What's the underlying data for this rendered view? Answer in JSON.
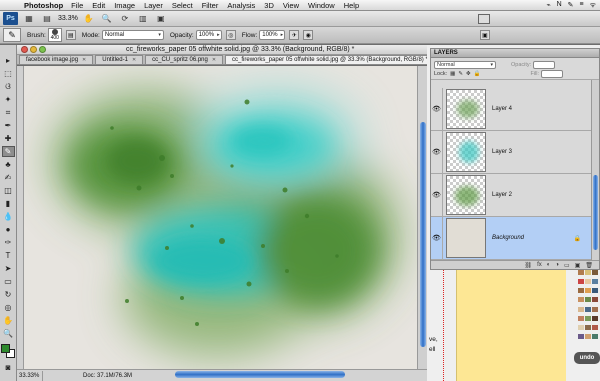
{
  "menubar": {
    "app_name": "Photoshop",
    "items": [
      "File",
      "Edit",
      "Image",
      "Layer",
      "Select",
      "Filter",
      "Analysis",
      "3D",
      "View",
      "Window",
      "Help"
    ],
    "status_icons": [
      "⌁",
      "N",
      "✎",
      "≡",
      "ᯤ"
    ]
  },
  "appbar": {
    "logo": "Ps",
    "zoom": "33.3%",
    "hand_icon": "hand-icon",
    "zoom_icon": "magnifier-icon"
  },
  "options": {
    "brush_label": "Brush:",
    "brush_size": "400",
    "mode_label": "Mode:",
    "mode_value": "Normal",
    "opacity_label": "Opacity:",
    "opacity_value": "100%",
    "flow_label": "Flow:",
    "flow_value": "100%"
  },
  "document": {
    "title": "cc_fireworks_paper 05 offwhite solid.jpg @ 33.3% (Background, RGB/8) *",
    "tabs": [
      {
        "label": "facebook image.jpg"
      },
      {
        "label": "Untitled-1"
      },
      {
        "label": "cc_CU_spritz 06.png"
      },
      {
        "label": "cc_fireworks_paper 05 offwhite solid.jpg @ 33.3% (Background, RGB/8) *"
      }
    ],
    "status_zoom": "33.33%",
    "doc_info": "Doc: 37.1M/76.3M"
  },
  "layers_panel": {
    "title": "LAYERS",
    "blend_mode": "Normal",
    "opacity_label": "Opacity:",
    "lock_label": "Lock:",
    "fill_label": "Fill:",
    "layers": [
      {
        "name": "Layer 4"
      },
      {
        "name": "Layer 3"
      },
      {
        "name": "Layer 2"
      },
      {
        "name": "Background"
      }
    ],
    "footer_icons": [
      "⛓",
      "fx",
      "◐",
      "◑",
      "▭",
      "▣",
      "🗑"
    ]
  },
  "right_side": {
    "stray_text_1": "ve,",
    "stray_text_2": "ell",
    "undo_label": "undo"
  },
  "colors": {
    "foreground": "#2e8a2e",
    "background": "#ffffff",
    "selection": "#b3cff5",
    "accent_blue": "#2f6fc6",
    "paint_green": "#4d8f35",
    "paint_teal": "#2cc7c2"
  }
}
